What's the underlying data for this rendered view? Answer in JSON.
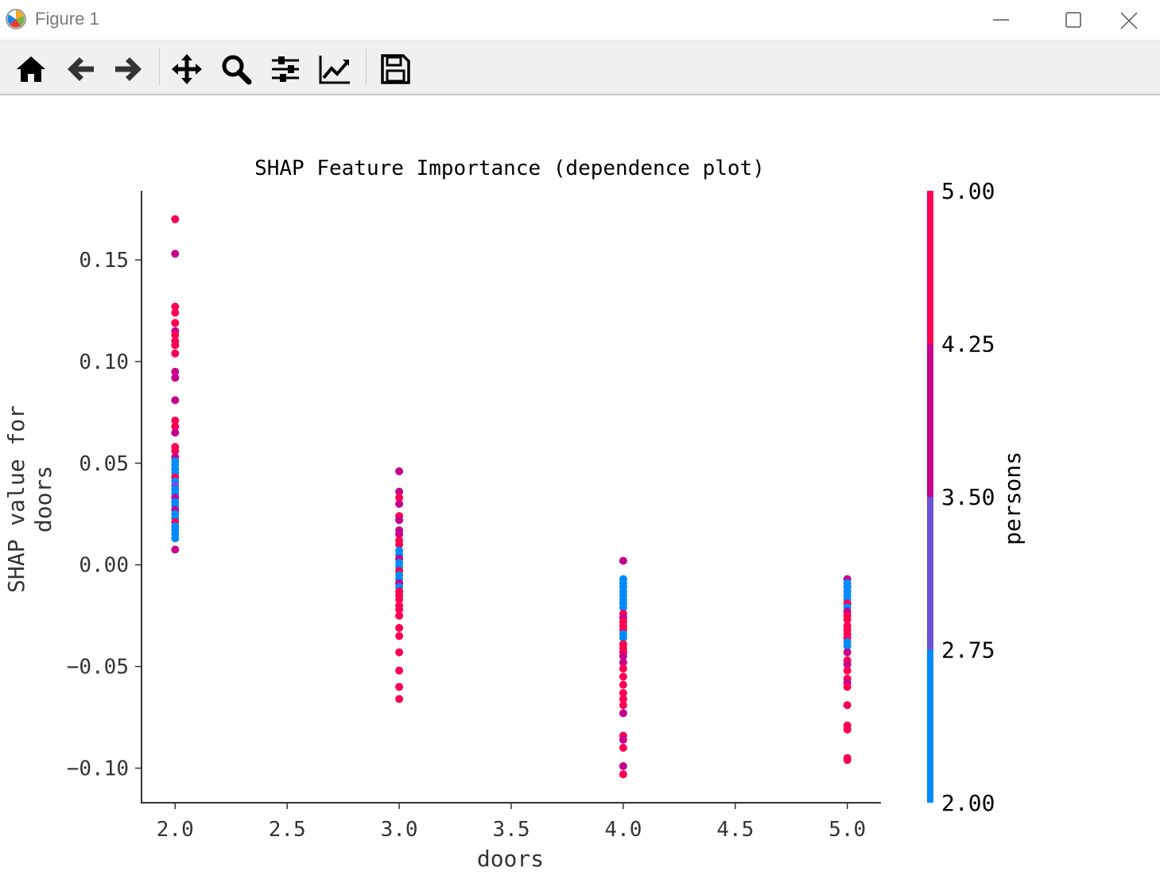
{
  "window": {
    "title": "Figure 1",
    "controls": [
      "minimize",
      "maximize",
      "close"
    ]
  },
  "toolbar": {
    "buttons": [
      {
        "name": "home",
        "icon": "home-icon"
      },
      {
        "name": "back",
        "icon": "arrow-left-icon"
      },
      {
        "name": "forward",
        "icon": "arrow-right-icon"
      },
      {
        "name": "pan",
        "icon": "move-icon"
      },
      {
        "name": "zoom",
        "icon": "zoom-icon"
      },
      {
        "name": "configure-subplots",
        "icon": "sliders-icon"
      },
      {
        "name": "edit-axes",
        "icon": "line-chart-icon"
      },
      {
        "name": "save",
        "icon": "floppy-disk-icon"
      }
    ]
  },
  "chart_data": {
    "type": "scatter",
    "title": "SHAP Feature Importance (dependence plot)",
    "xlabel": "doors",
    "ylabel": "SHAP value for\ndoors",
    "xlim": [
      1.85,
      5.15
    ],
    "ylim": [
      -0.117,
      0.184
    ],
    "x_ticks": [
      "2.0",
      "2.5",
      "3.0",
      "3.5",
      "4.0",
      "4.5",
      "5.0"
    ],
    "x_tick_values": [
      2.0,
      2.5,
      3.0,
      3.5,
      4.0,
      4.5,
      5.0
    ],
    "y_ticks": [
      "0.15",
      "0.10",
      "0.05",
      "0.00",
      "−0.05",
      "−0.10"
    ],
    "y_tick_values": [
      0.15,
      0.1,
      0.05,
      0.0,
      -0.05,
      -0.1
    ],
    "grid": false,
    "colorbar": {
      "label": "persons",
      "min": 2.0,
      "max": 5.0,
      "ticks": [
        "5.00",
        "4.25",
        "3.50",
        "2.75",
        "2.00"
      ],
      "tick_values": [
        5.0,
        4.25,
        3.5,
        2.75,
        2.0
      ],
      "colors": {
        "2": "#008bfb",
        "3": "#6c52d6",
        "4": "#c7018d",
        "5": "#ff0052"
      }
    },
    "points": [
      {
        "x": 2,
        "y": 0.17,
        "persons": 5
      },
      {
        "x": 2,
        "y": 0.153,
        "persons": 4
      },
      {
        "x": 2,
        "y": 0.127,
        "persons": 5
      },
      {
        "x": 2,
        "y": 0.124,
        "persons": 5
      },
      {
        "x": 2,
        "y": 0.119,
        "persons": 5
      },
      {
        "x": 2,
        "y": 0.115,
        "persons": 4
      },
      {
        "x": 2,
        "y": 0.113,
        "persons": 5
      },
      {
        "x": 2,
        "y": 0.11,
        "persons": 5
      },
      {
        "x": 2,
        "y": 0.108,
        "persons": 5
      },
      {
        "x": 2,
        "y": 0.104,
        "persons": 5
      },
      {
        "x": 2,
        "y": 0.095,
        "persons": 4
      },
      {
        "x": 2,
        "y": 0.092,
        "persons": 4
      },
      {
        "x": 2,
        "y": 0.081,
        "persons": 4
      },
      {
        "x": 2,
        "y": 0.071,
        "persons": 5
      },
      {
        "x": 2,
        "y": 0.068,
        "persons": 5
      },
      {
        "x": 2,
        "y": 0.065,
        "persons": 4
      },
      {
        "x": 2,
        "y": 0.058,
        "persons": 5
      },
      {
        "x": 2,
        "y": 0.056,
        "persons": 5
      },
      {
        "x": 2,
        "y": 0.053,
        "persons": 4
      },
      {
        "x": 2,
        "y": 0.051,
        "persons": 2
      },
      {
        "x": 2,
        "y": 0.049,
        "persons": 2
      },
      {
        "x": 2,
        "y": 0.047,
        "persons": 2
      },
      {
        "x": 2,
        "y": 0.045,
        "persons": 2
      },
      {
        "x": 2,
        "y": 0.043,
        "persons": 5
      },
      {
        "x": 2,
        "y": 0.041,
        "persons": 2
      },
      {
        "x": 2,
        "y": 0.039,
        "persons": 3
      },
      {
        "x": 2,
        "y": 0.037,
        "persons": 2
      },
      {
        "x": 2,
        "y": 0.035,
        "persons": 2
      },
      {
        "x": 2,
        "y": 0.033,
        "persons": 4
      },
      {
        "x": 2,
        "y": 0.031,
        "persons": 2
      },
      {
        "x": 2,
        "y": 0.029,
        "persons": 2
      },
      {
        "x": 2,
        "y": 0.027,
        "persons": 4
      },
      {
        "x": 2,
        "y": 0.025,
        "persons": 2
      },
      {
        "x": 2,
        "y": 0.023,
        "persons": 2
      },
      {
        "x": 2,
        "y": 0.021,
        "persons": 5
      },
      {
        "x": 2,
        "y": 0.019,
        "persons": 2
      },
      {
        "x": 2,
        "y": 0.017,
        "persons": 2
      },
      {
        "x": 2,
        "y": 0.015,
        "persons": 2
      },
      {
        "x": 2,
        "y": 0.013,
        "persons": 2
      },
      {
        "x": 2,
        "y": 0.0075,
        "persons": 4
      },
      {
        "x": 3,
        "y": 0.046,
        "persons": 4
      },
      {
        "x": 3,
        "y": 0.036,
        "persons": 4
      },
      {
        "x": 3,
        "y": 0.033,
        "persons": 5
      },
      {
        "x": 3,
        "y": 0.03,
        "persons": 4
      },
      {
        "x": 3,
        "y": 0.024,
        "persons": 5
      },
      {
        "x": 3,
        "y": 0.022,
        "persons": 4
      },
      {
        "x": 3,
        "y": 0.017,
        "persons": 4
      },
      {
        "x": 3,
        "y": 0.015,
        "persons": 4
      },
      {
        "x": 3,
        "y": 0.012,
        "persons": 5
      },
      {
        "x": 3,
        "y": 0.01,
        "persons": 5
      },
      {
        "x": 3,
        "y": 0.007,
        "persons": 2
      },
      {
        "x": 3,
        "y": 0.005,
        "persons": 2
      },
      {
        "x": 3,
        "y": 0.003,
        "persons": 4
      },
      {
        "x": 3,
        "y": 0.001,
        "persons": 2
      },
      {
        "x": 3,
        "y": -0.001,
        "persons": 2
      },
      {
        "x": 3,
        "y": -0.003,
        "persons": 5
      },
      {
        "x": 3,
        "y": -0.005,
        "persons": 2
      },
      {
        "x": 3,
        "y": -0.007,
        "persons": 2
      },
      {
        "x": 3,
        "y": -0.009,
        "persons": 4
      },
      {
        "x": 3,
        "y": -0.011,
        "persons": 2
      },
      {
        "x": 3,
        "y": -0.013,
        "persons": 5
      },
      {
        "x": 3,
        "y": -0.015,
        "persons": 5
      },
      {
        "x": 3,
        "y": -0.017,
        "persons": 5
      },
      {
        "x": 3,
        "y": -0.02,
        "persons": 5
      },
      {
        "x": 3,
        "y": -0.022,
        "persons": 5
      },
      {
        "x": 3,
        "y": -0.025,
        "persons": 5
      },
      {
        "x": 3,
        "y": -0.031,
        "persons": 5
      },
      {
        "x": 3,
        "y": -0.035,
        "persons": 5
      },
      {
        "x": 3,
        "y": -0.043,
        "persons": 5
      },
      {
        "x": 3,
        "y": -0.052,
        "persons": 5
      },
      {
        "x": 3,
        "y": -0.06,
        "persons": 5
      },
      {
        "x": 3,
        "y": -0.066,
        "persons": 5
      },
      {
        "x": 4,
        "y": 0.002,
        "persons": 4
      },
      {
        "x": 4,
        "y": -0.007,
        "persons": 2
      },
      {
        "x": 4,
        "y": -0.009,
        "persons": 2
      },
      {
        "x": 4,
        "y": -0.011,
        "persons": 2
      },
      {
        "x": 4,
        "y": -0.013,
        "persons": 2
      },
      {
        "x": 4,
        "y": -0.015,
        "persons": 2
      },
      {
        "x": 4,
        "y": -0.017,
        "persons": 2
      },
      {
        "x": 4,
        "y": -0.019,
        "persons": 2
      },
      {
        "x": 4,
        "y": -0.021,
        "persons": 2
      },
      {
        "x": 4,
        "y": -0.024,
        "persons": 5
      },
      {
        "x": 4,
        "y": -0.026,
        "persons": 4
      },
      {
        "x": 4,
        "y": -0.028,
        "persons": 5
      },
      {
        "x": 4,
        "y": -0.03,
        "persons": 5
      },
      {
        "x": 4,
        "y": -0.032,
        "persons": 5
      },
      {
        "x": 4,
        "y": -0.034,
        "persons": 2
      },
      {
        "x": 4,
        "y": -0.036,
        "persons": 2
      },
      {
        "x": 4,
        "y": -0.039,
        "persons": 5
      },
      {
        "x": 4,
        "y": -0.041,
        "persons": 5
      },
      {
        "x": 4,
        "y": -0.043,
        "persons": 5
      },
      {
        "x": 4,
        "y": -0.045,
        "persons": 4
      },
      {
        "x": 4,
        "y": -0.048,
        "persons": 4
      },
      {
        "x": 4,
        "y": -0.051,
        "persons": 5
      },
      {
        "x": 4,
        "y": -0.055,
        "persons": 5
      },
      {
        "x": 4,
        "y": -0.059,
        "persons": 5
      },
      {
        "x": 4,
        "y": -0.063,
        "persons": 5
      },
      {
        "x": 4,
        "y": -0.066,
        "persons": 5
      },
      {
        "x": 4,
        "y": -0.069,
        "persons": 5
      },
      {
        "x": 4,
        "y": -0.073,
        "persons": 4
      },
      {
        "x": 4,
        "y": -0.084,
        "persons": 5
      },
      {
        "x": 4,
        "y": -0.086,
        "persons": 4
      },
      {
        "x": 4,
        "y": -0.09,
        "persons": 5
      },
      {
        "x": 4,
        "y": -0.099,
        "persons": 4
      },
      {
        "x": 4,
        "y": -0.103,
        "persons": 5
      },
      {
        "x": 5,
        "y": -0.007,
        "persons": 4
      },
      {
        "x": 5,
        "y": -0.009,
        "persons": 2
      },
      {
        "x": 5,
        "y": -0.011,
        "persons": 2
      },
      {
        "x": 5,
        "y": -0.013,
        "persons": 2
      },
      {
        "x": 5,
        "y": -0.015,
        "persons": 2
      },
      {
        "x": 5,
        "y": -0.017,
        "persons": 2
      },
      {
        "x": 5,
        "y": -0.019,
        "persons": 5
      },
      {
        "x": 5,
        "y": -0.021,
        "persons": 2
      },
      {
        "x": 5,
        "y": -0.023,
        "persons": 4
      },
      {
        "x": 5,
        "y": -0.025,
        "persons": 5
      },
      {
        "x": 5,
        "y": -0.027,
        "persons": 5
      },
      {
        "x": 5,
        "y": -0.03,
        "persons": 5
      },
      {
        "x": 5,
        "y": -0.032,
        "persons": 5
      },
      {
        "x": 5,
        "y": -0.034,
        "persons": 5
      },
      {
        "x": 5,
        "y": -0.036,
        "persons": 5
      },
      {
        "x": 5,
        "y": -0.038,
        "persons": 2
      },
      {
        "x": 5,
        "y": -0.04,
        "persons": 2
      },
      {
        "x": 5,
        "y": -0.043,
        "persons": 4
      },
      {
        "x": 5,
        "y": -0.047,
        "persons": 5
      },
      {
        "x": 5,
        "y": -0.049,
        "persons": 4
      },
      {
        "x": 5,
        "y": -0.052,
        "persons": 5
      },
      {
        "x": 5,
        "y": -0.056,
        "persons": 5
      },
      {
        "x": 5,
        "y": -0.058,
        "persons": 4
      },
      {
        "x": 5,
        "y": -0.06,
        "persons": 5
      },
      {
        "x": 5,
        "y": -0.069,
        "persons": 5
      },
      {
        "x": 5,
        "y": -0.079,
        "persons": 5
      },
      {
        "x": 5,
        "y": -0.081,
        "persons": 5
      },
      {
        "x": 5,
        "y": -0.095,
        "persons": 5
      },
      {
        "x": 5,
        "y": -0.096,
        "persons": 5
      }
    ]
  }
}
